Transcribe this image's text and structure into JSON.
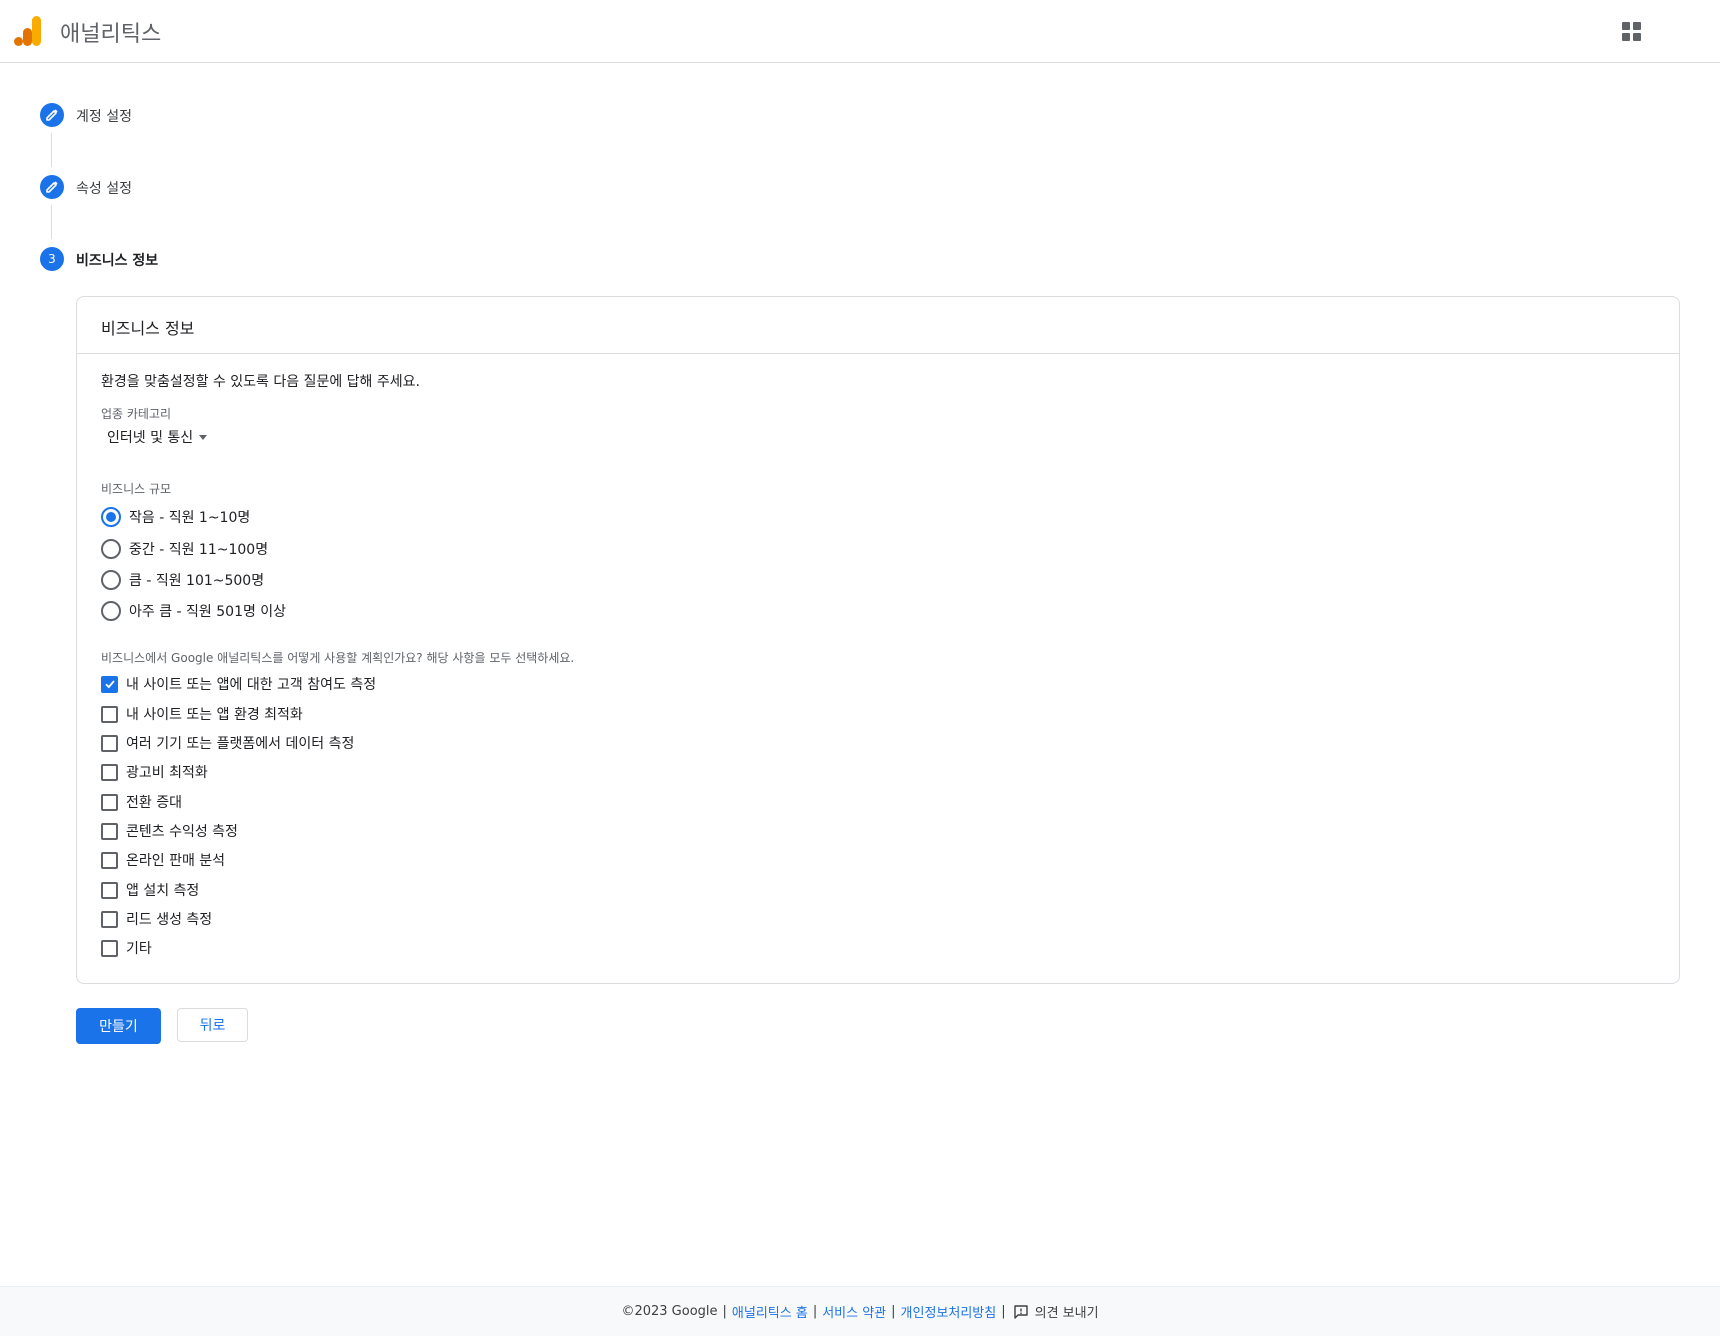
{
  "header": {
    "app_title": "애널리틱스",
    "logo_icon": "analytics-logo-icon",
    "apps_icon": "apps-grid-icon"
  },
  "stepper": {
    "steps": [
      {
        "label": "계정 설정",
        "state": "completed",
        "icon": "pencil-icon"
      },
      {
        "label": "속성 설정",
        "state": "completed",
        "icon": "pencil-icon"
      },
      {
        "label": "비즈니스 정보",
        "state": "active",
        "number": "3"
      }
    ]
  },
  "card": {
    "title": "비즈니스 정보",
    "intro": "환경을 맞춤설정할 수 있도록 다음 질문에 답해 주세요.",
    "industry": {
      "label": "업종 카테고리",
      "selected": "인터넷 및 통신"
    },
    "size": {
      "label": "비즈니스 규모",
      "options": [
        {
          "label": "작음 - 직원 1~10명",
          "checked": true
        },
        {
          "label": "중간 - 직원 11~100명",
          "checked": false
        },
        {
          "label": "큼 - 직원 101~500명",
          "checked": false
        },
        {
          "label": "아주 큼 - 직원 501명 이상",
          "checked": false
        }
      ]
    },
    "usage": {
      "label": "비즈니스에서 Google 애널리틱스를 어떻게 사용할 계획인가요? 해당 사항을 모두 선택하세요.",
      "options": [
        {
          "label": "내 사이트 또는 앱에 대한 고객 참여도 측정",
          "checked": true
        },
        {
          "label": "내 사이트 또는 앱 환경 최적화",
          "checked": false
        },
        {
          "label": "여러 기기 또는 플랫폼에서 데이터 측정",
          "checked": false
        },
        {
          "label": "광고비 최적화",
          "checked": false
        },
        {
          "label": "전환 증대",
          "checked": false
        },
        {
          "label": "콘텐츠 수익성 측정",
          "checked": false
        },
        {
          "label": "온라인 판매 분석",
          "checked": false
        },
        {
          "label": "앱 설치 측정",
          "checked": false
        },
        {
          "label": "리드 생성 측정",
          "checked": false
        },
        {
          "label": "기타",
          "checked": false
        }
      ]
    }
  },
  "buttons": {
    "create": "만들기",
    "back": "뒤로"
  },
  "footer": {
    "copyright": "©2023 Google",
    "links": [
      "애널리틱스 홈",
      "서비스 약관",
      "개인정보처리방침"
    ],
    "feedback": "의견 보내기"
  },
  "colors": {
    "primary": "#1a73e8",
    "logo_orange": "#f9ab00",
    "logo_dark_orange": "#e37400"
  }
}
